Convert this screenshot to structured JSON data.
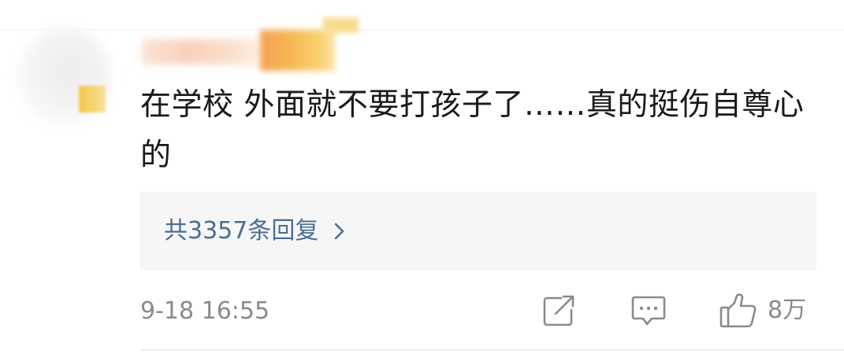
{
  "comment": {
    "text": "在学校 外面就不要打孩子了……真的挺伤自尊心的",
    "replies_label": "共3357条回复",
    "timestamp": "9-18 16:55",
    "like_count": "8万"
  },
  "icons": {
    "share": "share-icon",
    "comment": "comment-icon",
    "like": "thumbs-up-icon",
    "chevron": "chevron-right-icon"
  },
  "colors": {
    "link": "#4c6d92",
    "meta": "#8a8a8a",
    "text": "#1a1a1a",
    "reply_bg": "#f6f6f6"
  }
}
